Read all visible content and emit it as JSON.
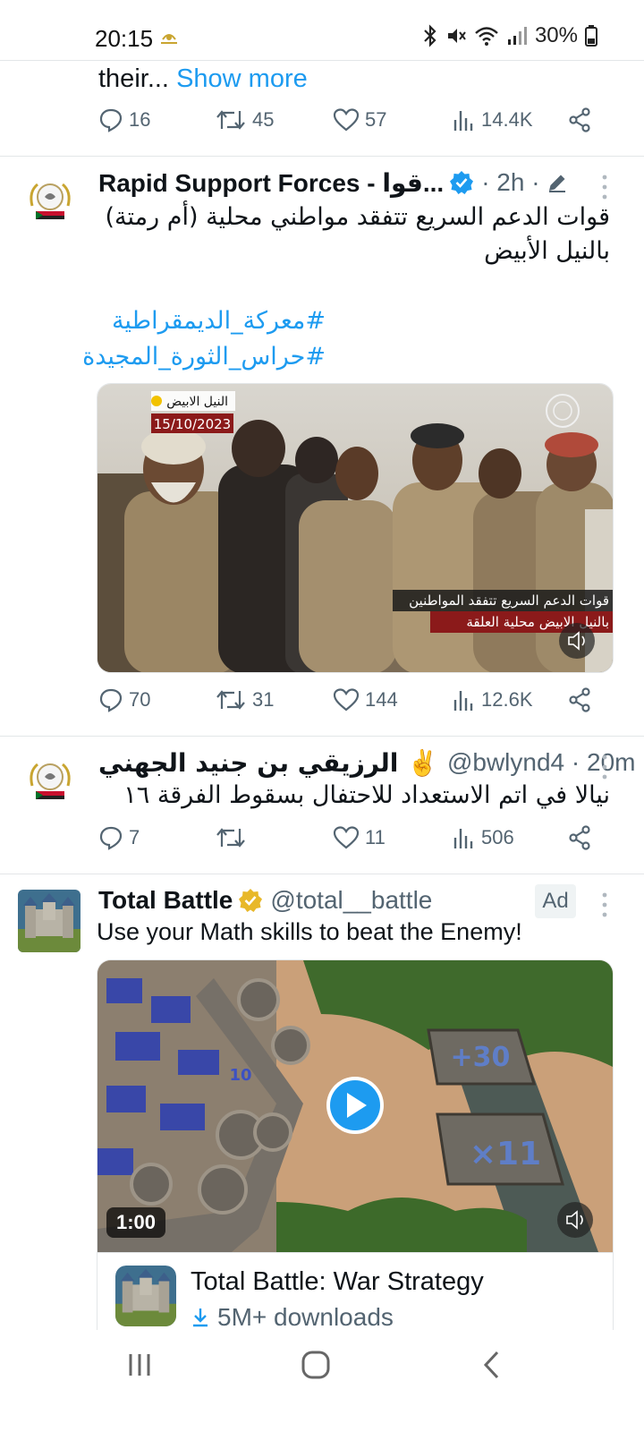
{
  "status_bar": {
    "time": "20:15",
    "battery": "30%",
    "icons": [
      "bluetooth-icon",
      "mute-icon",
      "wifi-icon",
      "signal-icon",
      "battery-icon"
    ]
  },
  "previous_tweet": {
    "text_tail": "their...",
    "show_more": "Show more",
    "stats": {
      "replies": "16",
      "reposts": "45",
      "likes": "57",
      "views": "14.4K"
    }
  },
  "tweets": [
    {
      "author": "Rapid Support Forces - قوا...",
      "time": "· 2h ·",
      "text_line1": "قوات الدعم السريع تتفقد مواطني محلية (أم رمتة)",
      "text_line2": "بالنيل الأبيض",
      "hashtag1": "#معركة_الديمقراطية",
      "hashtag2": "#حراس_الثورة_المجيدة",
      "video_overlay": {
        "location": "النيل الابيض",
        "date": "15/10/2023",
        "caption1": "قوات الدعم السريع تتفقد المواطنين",
        "caption2": "بالنيل الابيض محلية العلقة"
      },
      "stats": {
        "replies": "70",
        "reposts": "31",
        "likes": "144",
        "views": "12.6K"
      }
    },
    {
      "author": "الرزيقي بن جنيد الجهني ✌️",
      "handle_time": "@bwlynd4 · 20m",
      "text": "نيالا في اتم الاستعداد للاحتفال بسقوط الفرقة ١٦",
      "stats": {
        "replies": "7",
        "reposts": "",
        "likes": "11",
        "views": "506"
      }
    },
    {
      "author": "Total Battle",
      "handle": "@total__battle",
      "ad_badge": "Ad",
      "text": "Use your Math skills to beat the Enemy!",
      "video": {
        "duration": "1:00",
        "label_top": "+30",
        "label_bottom": "×11",
        "unit_number": "10"
      },
      "card": {
        "title": "Total Battle: War Strategy",
        "downloads": "5M+ downloads"
      }
    }
  ],
  "colors": {
    "accent": "#1d9bf0",
    "text": "#0f1419",
    "muted": "#536471",
    "verified_gold": "#e8b829"
  }
}
